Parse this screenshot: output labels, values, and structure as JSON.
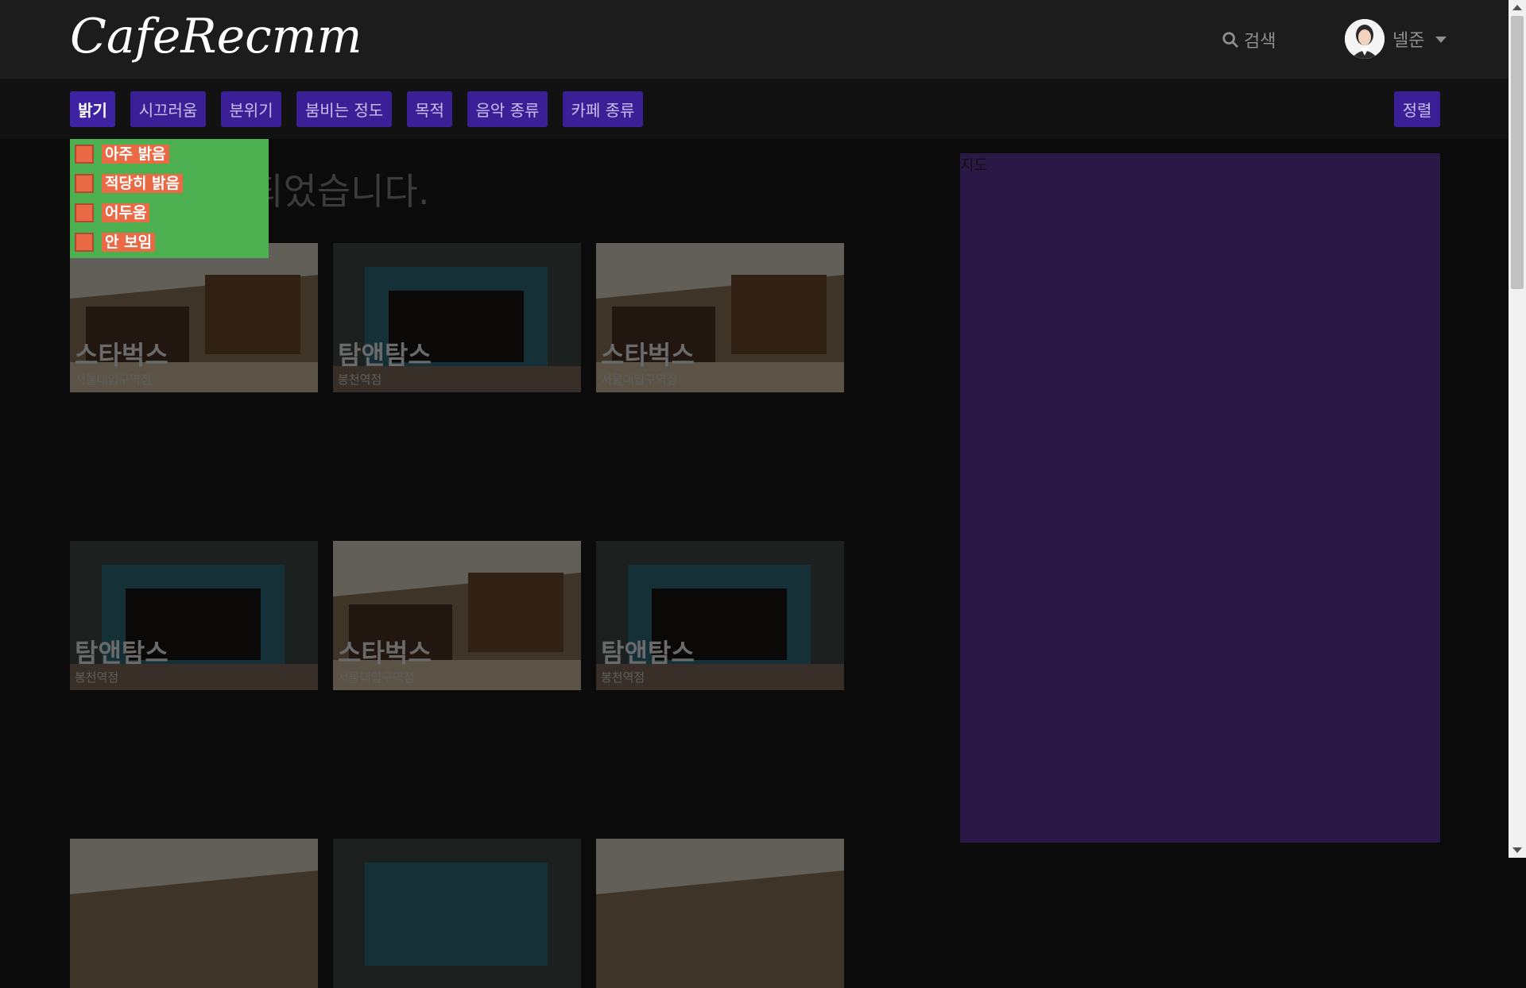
{
  "header": {
    "logo_text": "CafeRecmm",
    "search_label": "검색",
    "user_name": "넬준"
  },
  "filters": {
    "brightness": "밝기",
    "noise": "시끄러움",
    "mood": "분위기",
    "crowd": "붐비는 정도",
    "purpose": "목적",
    "music": "음악 종류",
    "cafe_type": "카페 종류",
    "sort": "정렬"
  },
  "brightness_dropdown": {
    "options": [
      "아주 밝음",
      "적당히 밝음",
      "어두움",
      "안 보임"
    ]
  },
  "results": {
    "message": "카페가 검색되었습니다."
  },
  "cafes": [
    {
      "name": "스타벅스",
      "branch": "서울대입구역점",
      "photo": "starbucks"
    },
    {
      "name": "탐앤탐스",
      "branch": "봉천역점",
      "photo": "tomntoms"
    },
    {
      "name": "스타벅스",
      "branch": "서울대입구역점",
      "photo": "starbucks"
    },
    {
      "name": "탐앤탐스",
      "branch": "봉천역점",
      "photo": "tomntoms"
    },
    {
      "name": "스타벅스",
      "branch": "서울대입구역점",
      "photo": "starbucks"
    },
    {
      "name": "탐앤탐스",
      "branch": "봉천역점",
      "photo": "tomntoms"
    },
    {
      "name": "",
      "branch": "",
      "photo": "starbucks"
    },
    {
      "name": "",
      "branch": "",
      "photo": "tomntoms"
    },
    {
      "name": "",
      "branch": "",
      "photo": "starbucks"
    }
  ],
  "map": {
    "label": "지도"
  },
  "colors": {
    "header_bg": "#1c1c1c",
    "filter_button": "#3a1f97",
    "dropdown_bg": "#4caf50",
    "checkbox": "#e96a45",
    "map_bg": "#2a1946"
  },
  "icons": {
    "search": "search-icon",
    "caret": "chevron-down-icon"
  }
}
